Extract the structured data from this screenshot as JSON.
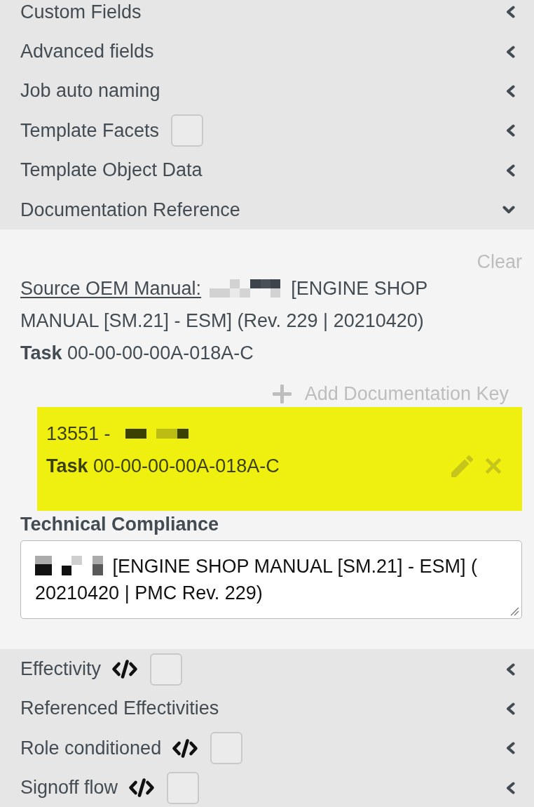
{
  "panels": [
    {
      "title": "Custom Fields",
      "expanded": false
    },
    {
      "title": "Advanced fields",
      "expanded": false
    },
    {
      "title": "Job auto naming",
      "expanded": false
    },
    {
      "title": "Template Facets",
      "expanded": false,
      "checkbox": {
        "checked": false
      }
    },
    {
      "title": "Template Object Data",
      "expanded": false
    },
    {
      "title": "Documentation Reference",
      "expanded": true,
      "content": {
        "clear": "Clear",
        "source": {
          "link": "Source OEM Manual:",
          "redacted": true,
          "text": "[ENGINE SHOP MANUAL [SM.21] - ESM] (Rev. 229 | 20210420)",
          "task": "**Task** 00-00-00-00A-018A-C"
        },
        "add_button": "Add Documentation Key",
        "keys": [
          {
            "number": "13551 -",
            "redacted": true,
            "task": "**Task** 00-00-00-00A-018A-C",
            "highlighted": true
          }
        ],
        "technical_compliance": {
          "label": "Technical Compliance",
          "redacted": true,
          "value": "[ENGINE SHOP MANUAL [SM.21] - ESM] ( 20210420 | PMC Rev. 229)"
        }
      }
    },
    {
      "title": "Effectivity",
      "expanded": false,
      "code": true,
      "checkbox": {
        "checked": false
      }
    },
    {
      "title": "Referenced Effectivities",
      "expanded": false
    },
    {
      "title": "Role conditioned",
      "expanded": false,
      "code": true,
      "checkbox": {
        "checked": false
      }
    },
    {
      "title": "Signoff flow",
      "expanded": false,
      "code": true,
      "checkbox": {
        "checked": false
      }
    }
  ]
}
